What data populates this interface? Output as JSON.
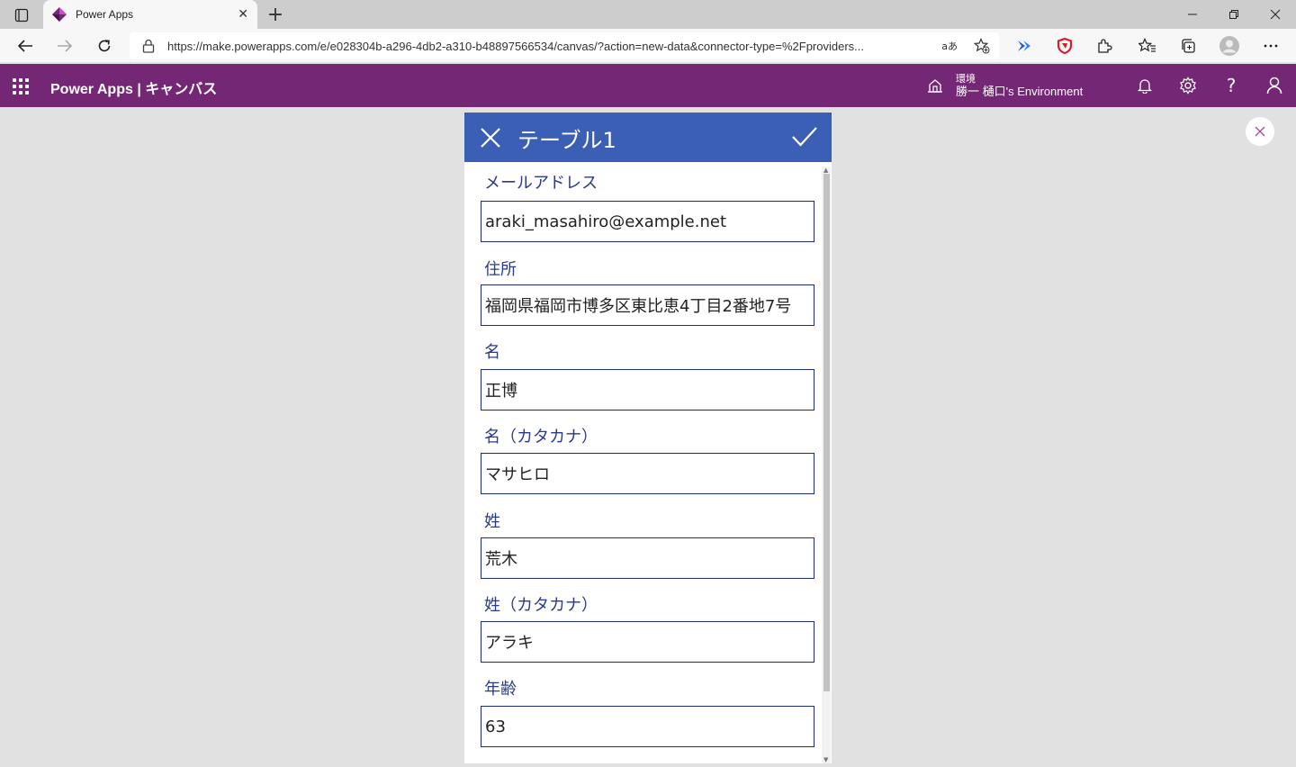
{
  "browser": {
    "tab_title": "Power Apps",
    "url": "https://make.powerapps.com/e/e028304b-a296-4db2-a310-b48897566534/canvas/?action=new-data&connector-type=%2Fproviders...",
    "read_aloud_label": "aあ"
  },
  "app": {
    "title": "Power Apps | キャンバス",
    "env_label": "環境",
    "env_name": "勝一 樋口's Environment",
    "brand_color": "#742774"
  },
  "form": {
    "title": "テーブル1",
    "header_color": "#3a5fb5",
    "fields": [
      {
        "label": "メールアドレス",
        "value": "araki_masahiro@example.net"
      },
      {
        "label": "住所",
        "value": "福岡県福岡市博多区東比恵4丁目2番地7号"
      },
      {
        "label": "名",
        "value": "正博"
      },
      {
        "label": "名（カタカナ）",
        "value": "マサヒロ"
      },
      {
        "label": "姓",
        "value": "荒木"
      },
      {
        "label": "姓（カタカナ）",
        "value": "アラキ"
      },
      {
        "label": "年齢",
        "value": "63"
      }
    ]
  }
}
